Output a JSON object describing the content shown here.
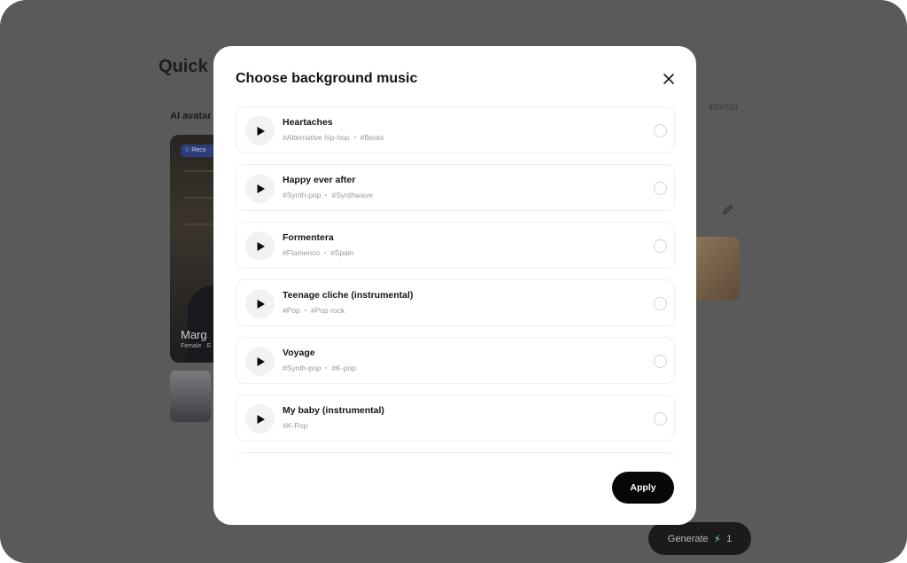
{
  "background": {
    "title": "Quick c",
    "section_label": "AI avatar",
    "counter": "480/700",
    "badge": "Reco",
    "avatar_name": "Marg",
    "avatar_meta": "Female · E",
    "generate_label": "Generate",
    "generate_count": "1"
  },
  "modal": {
    "title": "Choose background music",
    "apply_label": "Apply",
    "tracks": [
      {
        "name": "Heartaches",
        "tags": [
          "#Alternative hip-hop",
          "#Beats"
        ]
      },
      {
        "name": "Happy ever after",
        "tags": [
          "#Synth-pop",
          "#Synthwave"
        ]
      },
      {
        "name": "Formentera",
        "tags": [
          "#Flamenco",
          "#Spain"
        ]
      },
      {
        "name": "Teenage cliche (instrumental)",
        "tags": [
          "#Pop",
          "#Pop rock"
        ]
      },
      {
        "name": "Voyage",
        "tags": [
          "#Synth-pop",
          "#K-pop"
        ]
      },
      {
        "name": "My baby (instrumental)",
        "tags": [
          "#K-Pop"
        ]
      }
    ]
  },
  "colors": {
    "overlay": "#5a5a5a",
    "apply_bg": "#080808",
    "generate_bolt": "#7bd3a9"
  }
}
